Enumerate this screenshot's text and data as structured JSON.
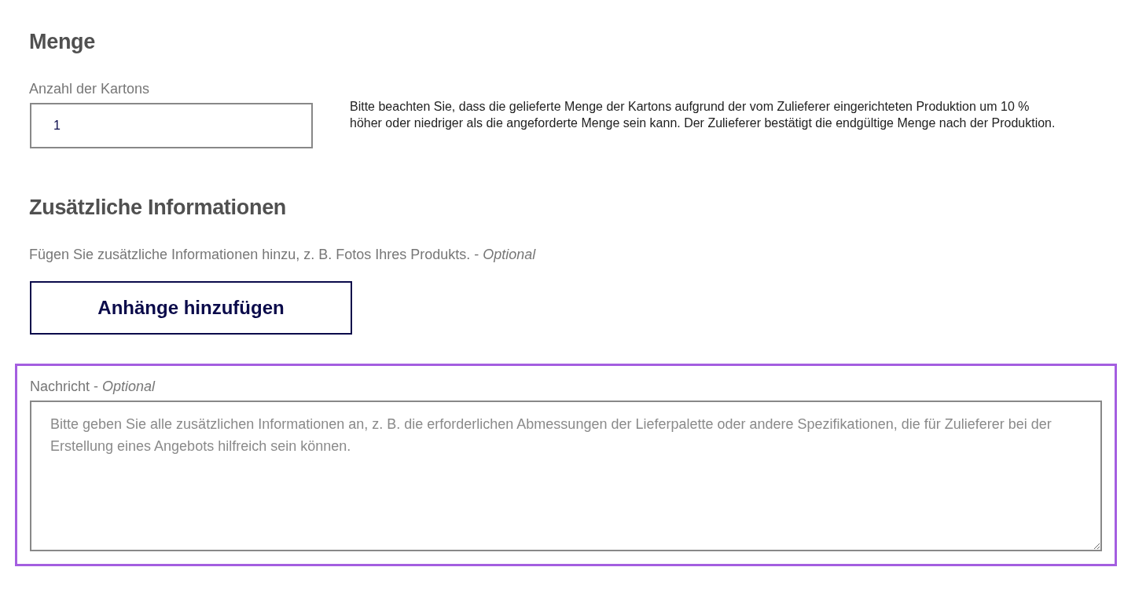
{
  "quantity": {
    "heading": "Menge",
    "field_label": "Anzahl der Kartons",
    "value": "1",
    "note": "Bitte beachten Sie, dass die gelieferte Menge der Kartons aufgrund der vom Zulieferer eingerichteten Produktion um 10 % höher oder niedriger als die angeforderte Menge sein kann. Der Zulieferer bestätigt die endgültige Menge nach der Produktion."
  },
  "additional": {
    "heading": "Zusätzliche Informationen",
    "description": "Fügen Sie zusätzliche Informationen hinzu, z. B. Fotos Ihres Produkts. - *Optional*",
    "button": "Anhänge hinzufügen"
  },
  "message": {
    "label": "Nachricht - *Optional*",
    "placeholder": "Bitte geben Sie alle zusätzlichen Informationen an, z. B. die erforderlichen Abmessungen der Lieferpalette oder andere Spezifikationen, die für Zulieferer bei der Erstellung eines Angebots hilfreich sein können.",
    "focused": true
  }
}
